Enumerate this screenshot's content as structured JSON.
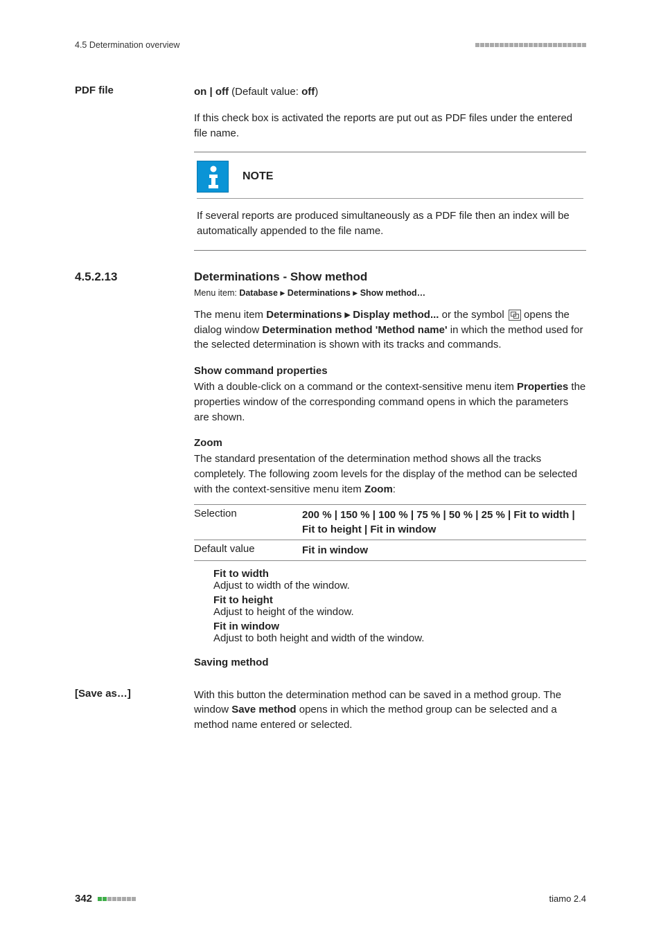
{
  "header": {
    "breadcrumb": "4.5 Determination overview"
  },
  "pdf_section": {
    "heading": "PDF file",
    "on_off_line_parts": {
      "p1": "on | off",
      "p2": " (Default value: ",
      "p3": "off",
      "p4": ")"
    },
    "body": "If this check box is activated the reports are put out as PDF files under the entered file name."
  },
  "note": {
    "label": "NOTE",
    "body": "If several reports are produced simultaneously as a PDF file then an index will be automatically appended to the file name."
  },
  "section": {
    "number": "4.5.2.13",
    "title": "Determinations - Show method",
    "menuitem": {
      "prefix": "Menu item: ",
      "p1": "Database",
      "p2": "Determinations",
      "p3": "Show method…"
    },
    "intro": {
      "t1": "The menu item ",
      "b1": "Determinations ▸ Display method...",
      "t2": " or the symbol ",
      "t3": " opens the dialog window ",
      "b2": "Determination method 'Method name'",
      "t4": " in which the method used for the selected determination is shown with its tracks and commands."
    },
    "show_cmd": {
      "heading": "Show command properties",
      "t1": "With a double-click on a command or the context-sensitive menu item ",
      "b1": "Properties",
      "t2": " the properties window of the corresponding command opens in which the parameters are shown."
    },
    "zoom": {
      "heading": "Zoom",
      "t1": "The standard presentation of the determination method shows all the tracks completely. The following zoom levels for the display of the method can be selected with the context-sensitive menu item ",
      "b1": "Zoom",
      "t2": ":"
    },
    "table": {
      "row1_label": "Selection",
      "row1_value": "200 % | 150 % | 100 % | 75 % | 50 % | 25 % | Fit to width | Fit to height | Fit in window",
      "row2_label": "Default value",
      "row2_value": "Fit in window"
    },
    "defs": {
      "d1t": "Fit to width",
      "d1d": "Adjust to width of the window.",
      "d2t": "Fit to height",
      "d2d": "Adjust to height of the window.",
      "d3t": "Fit in window",
      "d3d": "Adjust to both height and width of the window."
    },
    "saving": {
      "heading": "Saving method",
      "left_label": "[Save as…]",
      "t1": "With this button the determination method can be saved in a method group. The window ",
      "b1": "Save method",
      "t2": " opens in which the method group can be selected and a method name entered or selected."
    }
  },
  "footer": {
    "page": "342",
    "product": "tiamo 2.4"
  }
}
